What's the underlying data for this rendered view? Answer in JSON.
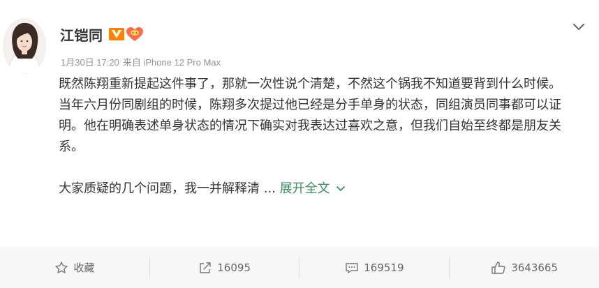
{
  "post": {
    "author": "江铠同",
    "date": "1月30日 17:20",
    "source": "来自 iPhone 12 Pro Max",
    "paragraphs": [
      "既然陈翔重新提起这件事了，那就一次性说个清楚，不然这个锅我不知道要背到什么时候。",
      "当年六月份同剧组的时候，陈翔多次提过他已经是分手单身的状态，同组演员同事都可以证明。他在明确表述单身状态的情况下确实对我表达过喜欢之意，但我们自始至终都是朋友关系。"
    ],
    "truncated_text": "大家质疑的几个问题，我一并解释清 ...",
    "expand_label": "展开全文"
  },
  "actions": {
    "favorite": "收藏",
    "repost": "16095",
    "comment": "169519",
    "like": "3643665"
  },
  "icons": {
    "verified": "orange-v-badge-icon",
    "level": "heart-level-badge-icon",
    "menu": "chevron-down-icon",
    "favorite": "star-icon",
    "repost": "share-icon",
    "comment": "comment-icon",
    "like": "thumbs-up-icon"
  },
  "colors": {
    "link": "#3f8f63",
    "verified": "#ff8200",
    "level": "#ff5a5a"
  }
}
